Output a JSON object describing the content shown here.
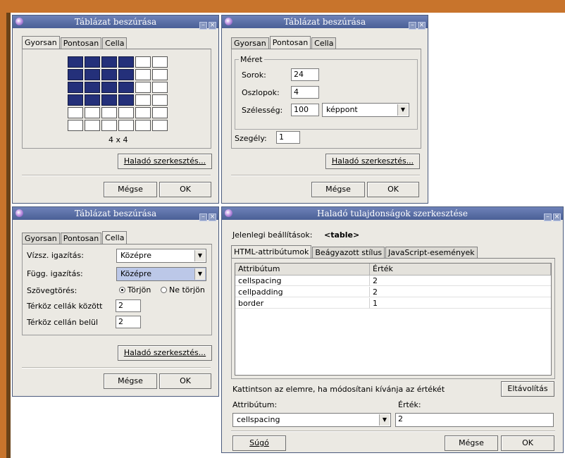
{
  "colors": {
    "desktop_orange": "#c8742c",
    "titlebar": "#5a6ea6",
    "selected_cell": "#24307a"
  },
  "win1": {
    "title": "Táblázat beszúrása",
    "tabs": [
      "Gyorsan",
      "Pontosan",
      "Cella"
    ],
    "active_tab": "Gyorsan",
    "grid": {
      "rows": 6,
      "cols": 6,
      "selected_rows": 4,
      "selected_cols": 4
    },
    "grid_label": "4 x 4",
    "advanced_button": "Haladó szerkesztés...",
    "cancel_button": "Mégse",
    "ok_button": "OK"
  },
  "win2": {
    "title": "Táblázat beszúrása",
    "tabs": [
      "Gyorsan",
      "Pontosan",
      "Cella"
    ],
    "active_tab": "Pontosan",
    "size_group": "Méret",
    "rows_label": "Sorok:",
    "rows_value": "24",
    "cols_label": "Oszlopok:",
    "cols_value": "4",
    "width_label": "Szélesség:",
    "width_value": "100",
    "width_unit": "képpont",
    "border_label": "Szegély:",
    "border_value": "1",
    "advanced_button": "Haladó szerkesztés...",
    "cancel_button": "Mégse",
    "ok_button": "OK"
  },
  "win3": {
    "title": "Táblázat beszúrása",
    "tabs": [
      "Gyorsan",
      "Pontosan",
      "Cella"
    ],
    "active_tab": "Cella",
    "halign_label": "Vízsz. igazítás:",
    "halign_value": "Középre",
    "valign_label": "Függ. igazítás:",
    "valign_value": "Középre",
    "wrap_label": "Szövegtörés:",
    "wrap_on": "Törjön",
    "wrap_off": "Ne törjön",
    "spacing_label": "Térköz cellák között",
    "spacing_value": "2",
    "padding_label": "Térköz cellán belül",
    "padding_value": "2",
    "advanced_button": "Haladó szerkesztés...",
    "cancel_button": "Mégse",
    "ok_button": "OK"
  },
  "win4": {
    "title": "Haladó tulajdonságok szerkesztése",
    "current_label": "Jelenlegi beállítások:",
    "current_value": "<table>",
    "tabs": [
      "HTML-attribútumok",
      "Beágyazott stílus",
      "JavaScript-események"
    ],
    "active_tab": "HTML-attribútumok",
    "columns": [
      "Attribútum",
      "Érték"
    ],
    "rows": [
      {
        "attr": "cellspacing",
        "value": "2"
      },
      {
        "attr": "cellpadding",
        "value": "2"
      },
      {
        "attr": "border",
        "value": "1"
      }
    ],
    "hint": "Kattintson az elemre, ha módosítani kívánja az értékét",
    "remove_button": "Eltávolítás",
    "attr_label": "Attribútum:",
    "value_label": "Érték:",
    "attr_input": "cellspacing",
    "value_input": "2",
    "help_button": "Súgó",
    "cancel_button": "Mégse",
    "ok_button": "OK"
  }
}
